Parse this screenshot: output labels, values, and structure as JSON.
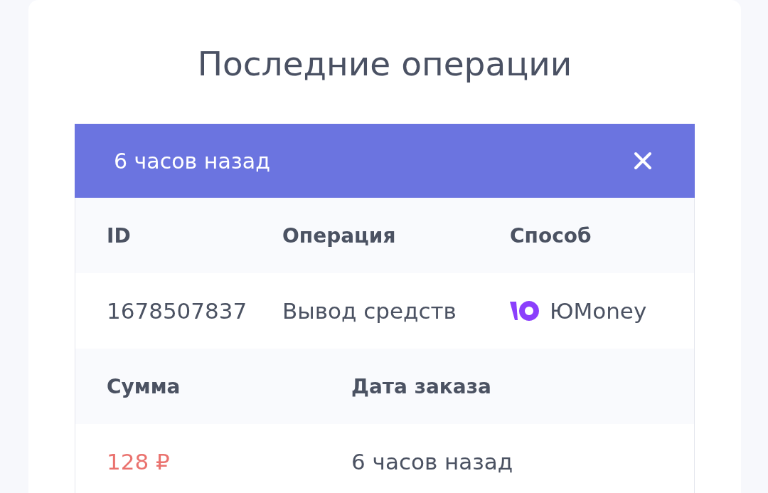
{
  "title": "Последние операции",
  "operation": {
    "header": {
      "title": "6 часов назад"
    },
    "sections": [
      {
        "columns": [
          "ID",
          "Операция",
          "Способ"
        ],
        "values": [
          {
            "kind": "plain",
            "text": "1678507837"
          },
          {
            "kind": "plain",
            "text": "Вывод средств"
          },
          {
            "kind": "payment",
            "text": "ЮMoney"
          }
        ]
      },
      {
        "columns": [
          "Сумма",
          "Дата заказа"
        ],
        "values": [
          {
            "kind": "amount",
            "text": "128 ₽"
          },
          {
            "kind": "plain",
            "text": "6 часов назад"
          }
        ]
      }
    ]
  }
}
